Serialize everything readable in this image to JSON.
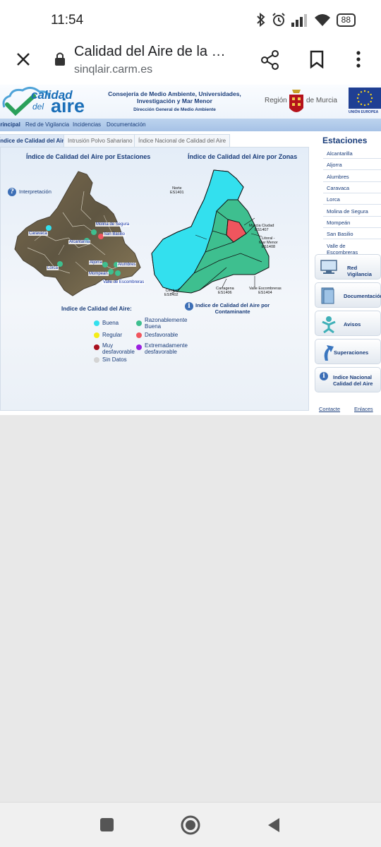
{
  "status_bar": {
    "time": "11:54",
    "battery": "88"
  },
  "browser": {
    "title": "Calidad del Aire de la …",
    "url": "sinqlair.carm.es"
  },
  "header": {
    "logo_line1": "calidad",
    "logo_line2": "del",
    "logo_line3": "aire",
    "consejeria_line1": "Consejería de Medio Ambiente, Universidades,",
    "consejeria_line2": "Investigación y Mar Menor",
    "direccion": "Dirección General de Medio Ambiente",
    "region_word": "Región",
    "de_murcia": "de Murcia",
    "eu_label": "UNIÓN EUROPEA"
  },
  "navbar": {
    "items": [
      "Principal",
      "Red de Vigilancia",
      "Incidencias",
      "Documentación"
    ]
  },
  "tabs": [
    "Índice de Calidad del Aire",
    "Intrusión Polvo Sahariano",
    "Índice Nacional de Calidad del Aire"
  ],
  "left_section": {
    "title": "Índice de Calidad del Aire por Estaciones",
    "interpretacion": "Interpretación",
    "stations": [
      {
        "label": "Caravaca",
        "status": "good"
      },
      {
        "label": "Molina de Segura",
        "status": "reasonable"
      },
      {
        "label": "San Basilio",
        "status": "unfavorable"
      },
      {
        "label": "Alcantarilla",
        "status": "reasonable"
      },
      {
        "label": "Lorca",
        "status": "reasonable"
      },
      {
        "label": "Alumbres",
        "status": "reasonable"
      },
      {
        "label": "Aljorra",
        "status": "reasonable"
      },
      {
        "label": "Mompeán",
        "status": "reasonable"
      },
      {
        "label": "Valle de Escombreras",
        "status": "reasonable"
      }
    ]
  },
  "right_section": {
    "title": "Índice de Calidad del Aire por Zonas",
    "zones": {
      "norte": {
        "name": "Norte",
        "code": "ES1401"
      },
      "murcia": {
        "name": "Murcia Ciudad",
        "code": "ES1407"
      },
      "litoral_line1": "Litoral -",
      "litoral_line2": "Mar Menor",
      "litoral_code": "ES1408",
      "centro": {
        "name": "Centro",
        "code": "ES1402"
      },
      "cartagena": {
        "name": "Cartagena",
        "code": "ES1406"
      },
      "valle": {
        "name": "Valle Escombreras",
        "code": "ES1404"
      }
    },
    "contaminante_line1": "Indice de Calidad del Aire por",
    "contaminante_line2": "Contaminante"
  },
  "legend": {
    "title": "Indice de Calidad del Aire:",
    "buena": "Buena",
    "razonable_line1": "Razonablemente",
    "razonable_line2": "Buena",
    "regular": "Regular",
    "desfavorable": "Desfavorable",
    "muy_line1": "Muy",
    "muy_line2": "desfavorable",
    "extrem_line1": "Extremadamente",
    "extrem_line2": "desfavorable",
    "sin_datos": "Sin Datos"
  },
  "colors": {
    "good": "#33e0ee",
    "reasonable": "#3ebf8f",
    "regular": "#f4ec16",
    "unfavorable": "#f0555e",
    "very_unfavorable": "#a8101e",
    "extreme": "#9a1fe0",
    "no_data": "#d4d4d4"
  },
  "sidebar": {
    "title": "Estaciones",
    "stations": [
      "Alcantarilla",
      "Aljorra",
      "Alumbres",
      "Caravaca",
      "Lorca",
      "Molina de Segura",
      "Mompeán",
      "San Basilio"
    ],
    "valle_line1": "Valle de",
    "valle_line2": "Escombreras",
    "btn_red": "Red Vigilancia",
    "btn_doc": "Documentación",
    "btn_avisos": "Avisos",
    "btn_superaciones": "Superaciones",
    "btn_indice_line1": "Indice Nacional",
    "btn_indice_line2": "Calidad del Aire"
  },
  "footer": {
    "contacto": "Contacte",
    "enlaces": "Enlaces"
  }
}
